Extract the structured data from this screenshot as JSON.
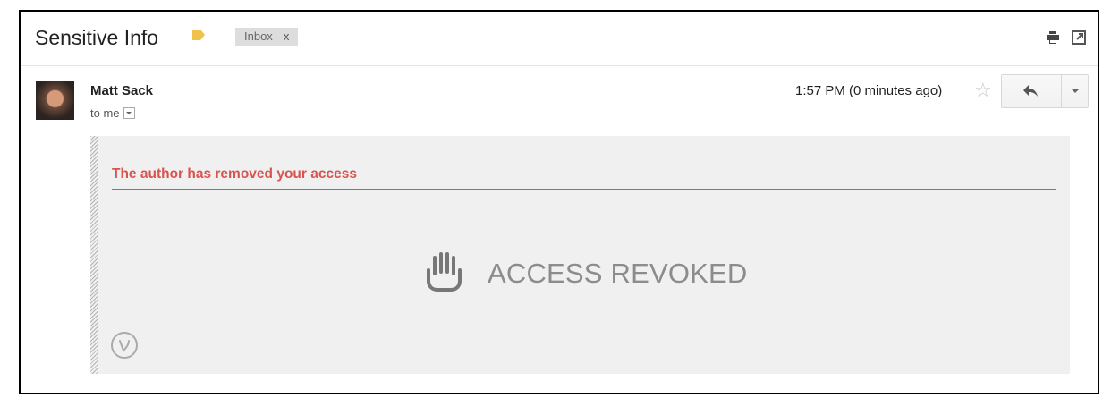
{
  "email": {
    "subject": "Sensitive Info",
    "label_chip": "Inbox",
    "label_chip_remove": "x",
    "sender_name": "Matt Sack",
    "recipient": "to me",
    "timestamp": "1:57 PM (0 minutes ago)"
  },
  "icons": {
    "label_tag": "label-tag-icon",
    "print": "print-icon",
    "new_window": "new-window-icon",
    "star": "star-icon",
    "reply": "reply-icon",
    "more": "chevron-down-icon",
    "hand": "hand-stop-icon",
    "brand": "virtru-v-icon"
  },
  "access_card": {
    "notice": "The author has removed your access",
    "status": "ACCESS REVOKED"
  },
  "colors": {
    "label_tag": "#f0c24b",
    "notice": "#d9534f",
    "card_bg": "#f0f0f0",
    "status_text": "#8c8c8c"
  }
}
